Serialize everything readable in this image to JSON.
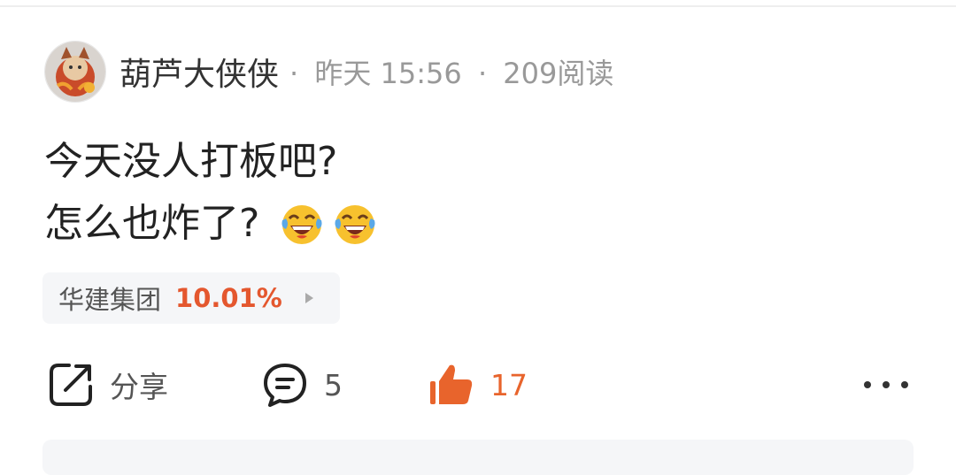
{
  "post": {
    "author": "葫芦大侠侠",
    "separator": "·",
    "date": "昨天 15:56",
    "views": "209阅读",
    "lines": [
      "今天没人打板吧?",
      "怎么也炸了?"
    ],
    "emoji": [
      "tears-of-joy-emoji",
      "tears-of-joy-emoji"
    ]
  },
  "stock": {
    "name": "华建集团",
    "change": "10.01%",
    "change_color": "#e4572e"
  },
  "actions": {
    "share_label": "分享",
    "comment_count": "5",
    "like_count": "17",
    "like_color": "#e8642c"
  },
  "icons": {
    "share": "share-icon",
    "comment": "comment-icon",
    "like": "thumbs-up-icon",
    "more": "more-icon",
    "arrow": "chevron-right-icon"
  }
}
